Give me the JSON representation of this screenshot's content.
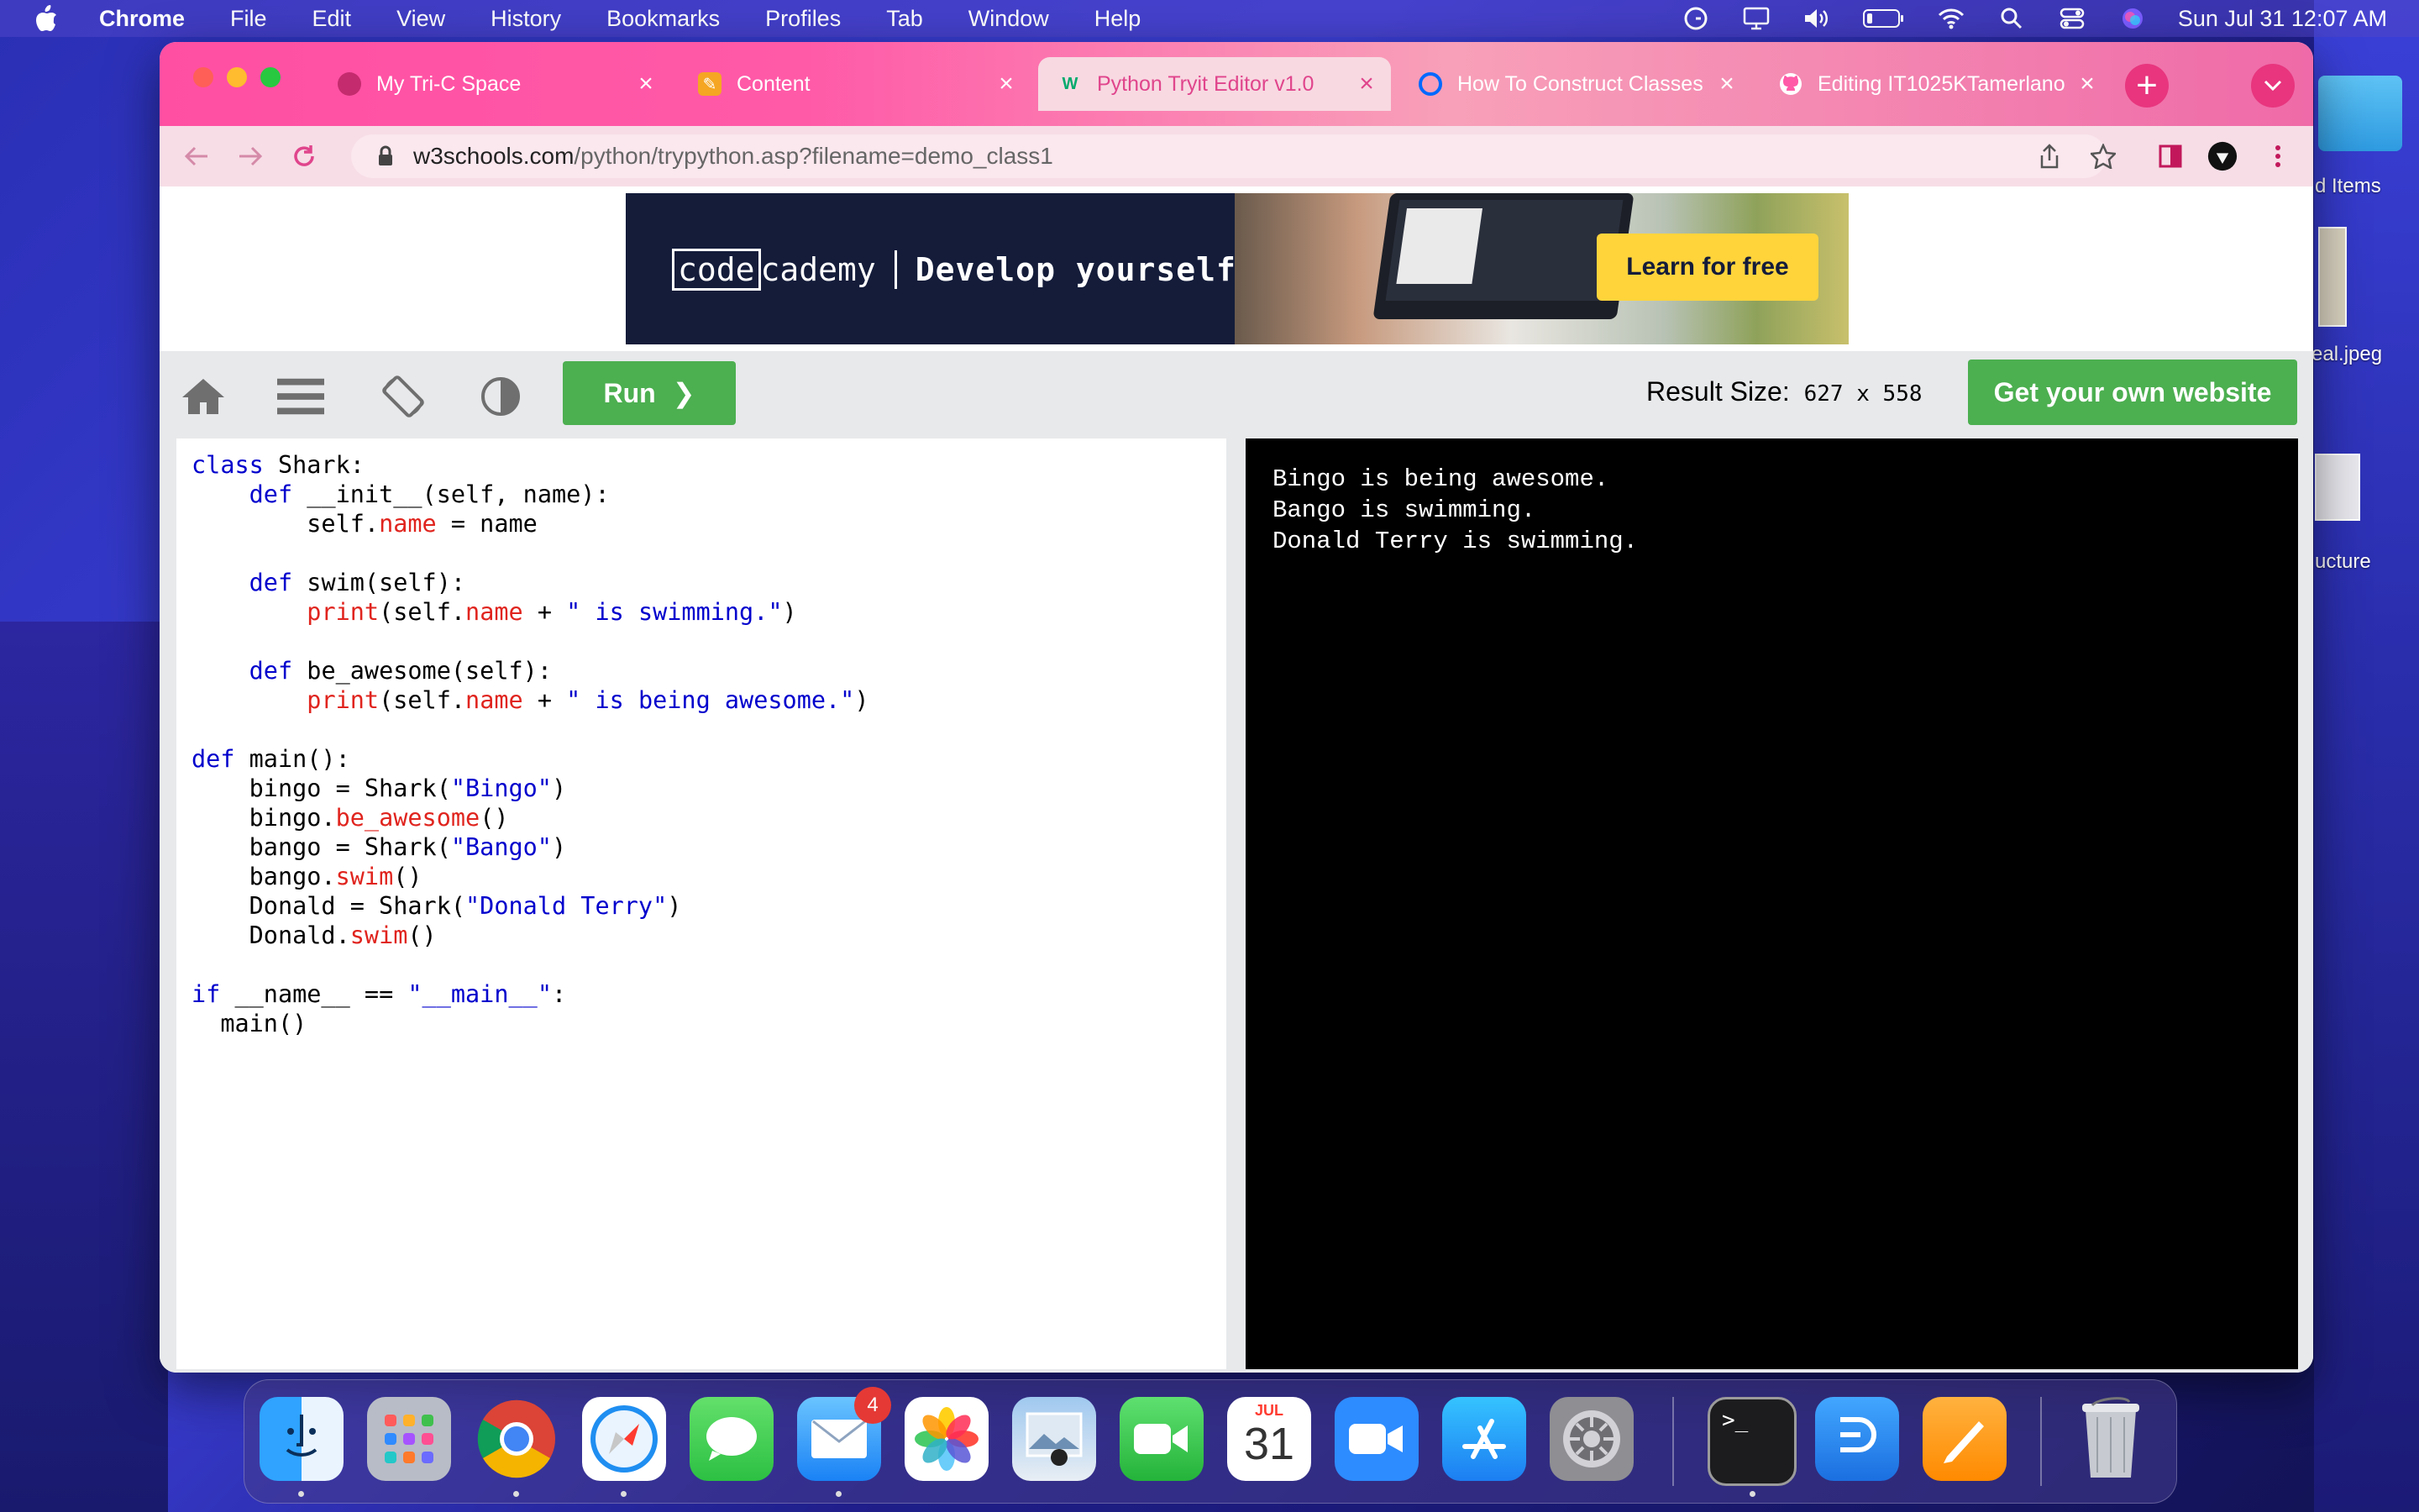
{
  "menubar": {
    "app": "Chrome",
    "items": [
      "File",
      "Edit",
      "View",
      "History",
      "Bookmarks",
      "Profiles",
      "Tab",
      "Window",
      "Help"
    ],
    "clock": "Sun Jul 31  12:07 AM"
  },
  "desktop": {
    "labels": [
      "d Items",
      "eal.jpeg",
      "ucture"
    ]
  },
  "tabs": [
    {
      "title": "My Tri-C Space"
    },
    {
      "title": "Content"
    },
    {
      "title": "Python Tryit Editor v1.0"
    },
    {
      "title": "How To Construct Classes"
    },
    {
      "title": "Editing IT1025KTamerlano"
    }
  ],
  "address": {
    "host": "w3schools.com",
    "path": "/python/trypython.asp?filename=demo_class1"
  },
  "ad": {
    "brand_box": "code",
    "brand_rest": "cademy",
    "tagline": "Develop yourself",
    "cta": "Learn for free"
  },
  "tryit": {
    "run_label": "Run",
    "result_size_label": "Result Size:",
    "result_size_value": "627 x 558",
    "get_own_label": "Get your own website"
  },
  "code_lines": [
    "class Shark:",
    "    def __init__(self, name):",
    "        self.name = name",
    "",
    "    def swim(self):",
    "        print(self.name + \" is swimming.\")",
    "",
    "    def be_awesome(self):",
    "        print(self.name + \" is being awesome.\")",
    "",
    "def main():",
    "    bingo = Shark(\"Bingo\")",
    "    bingo.be_awesome()",
    "    bango = Shark(\"Bango\")",
    "    bango.swim()",
    "    Donald = Shark(\"Donald Terry\")",
    "    Donald.swim()",
    "",
    "if __name__ == \"__main__\":",
    "  main()"
  ],
  "output_lines": [
    "Bingo is being awesome.",
    "Bango is swimming.",
    "Donald Terry is swimming."
  ],
  "dock": {
    "apps": [
      "finder-icon",
      "launchpad-icon",
      "chrome-icon",
      "safari-icon",
      "messages-icon",
      "mail-icon",
      "photos-icon",
      "preview-icon",
      "facetime-icon",
      "calendar-icon",
      "zoom-icon",
      "app-store-icon",
      "system-preferences-icon",
      "terminal-icon",
      "dict-icon",
      "pages-icon",
      "trash-icon"
    ],
    "mail_badge": "4",
    "calendar_month": "JUL",
    "calendar_day": "31",
    "terminal_prompt": ">_"
  },
  "colors": {
    "accent_green": "#4caf50",
    "tab_pink": "#ff4fa3",
    "code_keyword": "#0000cd",
    "code_attr": "#e0241e"
  }
}
